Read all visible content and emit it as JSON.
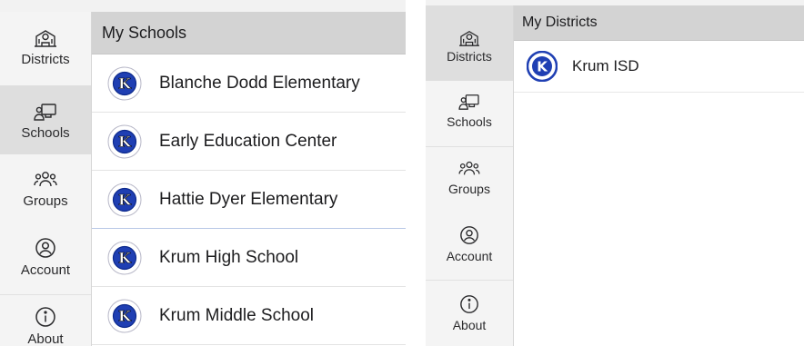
{
  "left_panel": {
    "header_title": "My Schools",
    "nav": [
      {
        "label": "Districts",
        "icon": "school-building-icon",
        "selected": false
      },
      {
        "label": "Schools",
        "icon": "chalkboard-teacher-icon",
        "selected": true
      },
      {
        "label": "Groups",
        "icon": "group-people-icon",
        "selected": false
      },
      {
        "label": "Account",
        "icon": "account-circle-icon",
        "selected": false
      },
      {
        "label": "About",
        "icon": "info-circle-icon",
        "selected": false
      }
    ],
    "items": [
      {
        "label": "Blanche Dodd Elementary",
        "logo": "krum-bobcats-seal-logo"
      },
      {
        "label": "Early Education Center",
        "logo": "krum-bobcats-seal-logo"
      },
      {
        "label": "Hattie Dyer Elementary",
        "logo": "krum-bobcats-seal-logo"
      },
      {
        "label": "Krum High School",
        "logo": "krum-bobcats-seal-logo"
      },
      {
        "label": "Krum Middle School",
        "logo": "krum-bobcats-seal-logo"
      }
    ]
  },
  "right_panel": {
    "header_title": "My Districts",
    "nav": [
      {
        "label": "Districts",
        "icon": "school-building-icon",
        "selected": true
      },
      {
        "label": "Schools",
        "icon": "chalkboard-teacher-icon",
        "selected": false
      },
      {
        "label": "Groups",
        "icon": "group-people-icon",
        "selected": false
      },
      {
        "label": "Account",
        "icon": "account-circle-icon",
        "selected": false
      },
      {
        "label": "About",
        "icon": "info-circle-icon",
        "selected": false
      }
    ],
    "items": [
      {
        "label": "Krum ISD",
        "logo": "krum-isd-logo"
      }
    ]
  },
  "colors": {
    "sidebar_bg": "#f4f4f4",
    "sidebar_selected": "#dedede",
    "header_bg": "#d3d3d3",
    "logo_blue": "#1f3fb3",
    "logo_ring": "#0d2a8c"
  }
}
